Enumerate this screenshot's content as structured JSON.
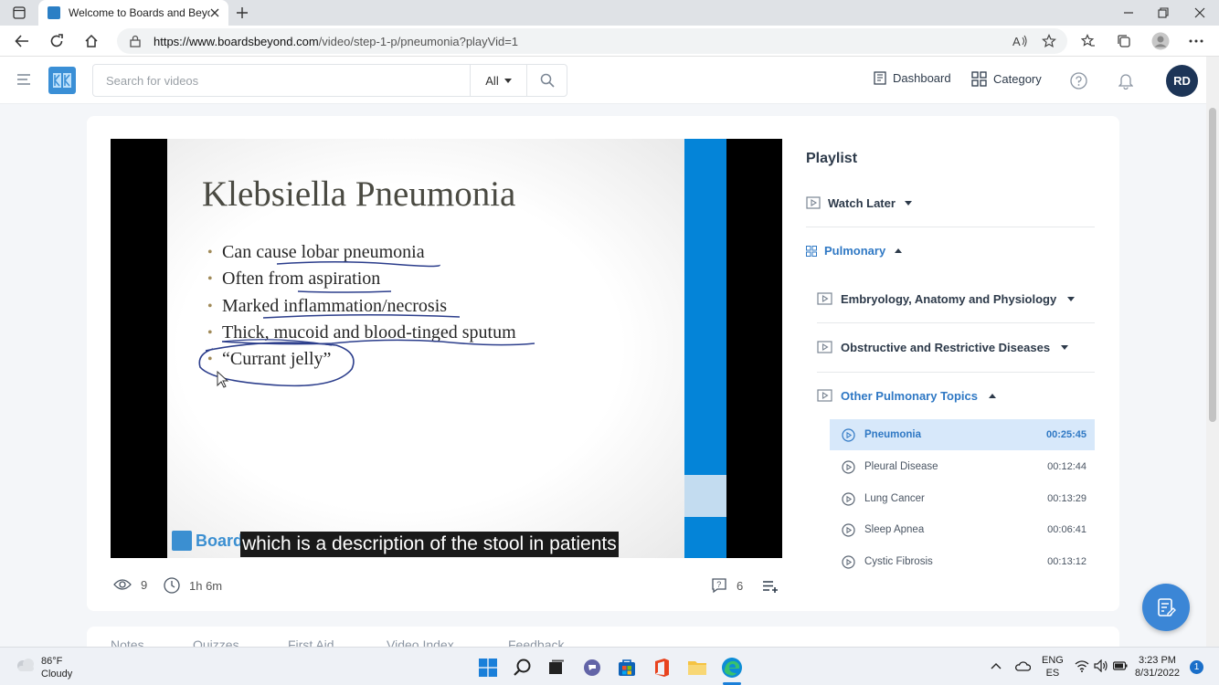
{
  "browser": {
    "tab_title": "Welcome to Boards and Beyond",
    "url_host": "https://www.boardsbeyond.com",
    "url_path": "/video/step-1-p/pneumonia?playVid=1"
  },
  "header": {
    "search_placeholder": "Search for videos",
    "search_scope": "All",
    "dashboard_label": "Dashboard",
    "category_label": "Category",
    "avatar_initials": "RD"
  },
  "video": {
    "slide_title": "Klebsiella Pneumonia",
    "bullets": [
      "Can cause lobar pneumonia",
      "Often from aspiration",
      "Marked inflammation/necrosis",
      "Thick, mucoid and blood-tinged sputum",
      "“Currant jelly”"
    ],
    "watermark": "Boards",
    "caption": "which is a description of the stool in patients",
    "views": "9",
    "duration": "1h 6m",
    "questions_count": "6"
  },
  "playlist": {
    "title": "Playlist",
    "watch_later": "Watch Later",
    "group": "Pulmonary",
    "sections": [
      "Embryology, Anatomy and Physiology",
      "Obstructive and Restrictive Diseases",
      "Other Pulmonary Topics"
    ],
    "videos": [
      {
        "name": "Pneumonia",
        "duration": "00:25:45",
        "active": true
      },
      {
        "name": "Pleural Disease",
        "duration": "00:12:44",
        "active": false
      },
      {
        "name": "Lung Cancer",
        "duration": "00:13:29",
        "active": false
      },
      {
        "name": "Sleep Apnea",
        "duration": "00:06:41",
        "active": false
      },
      {
        "name": "Cystic Fibrosis",
        "duration": "00:13:12",
        "active": false
      }
    ]
  },
  "lower_tabs": [
    "Notes",
    "Quizzes",
    "First Aid",
    "Video Index",
    "Feedback"
  ],
  "taskbar": {
    "temp": "86°F",
    "weather": "Cloudy",
    "lang_top": "ENG",
    "lang_bottom": "ES",
    "time": "3:23 PM",
    "date": "8/31/2022",
    "notifications": "1"
  },
  "colors": {
    "accent": "#3b86d6",
    "active_row": "#d7e8fa",
    "avatar": "#1d3557",
    "video_bar": "#0484d8"
  }
}
